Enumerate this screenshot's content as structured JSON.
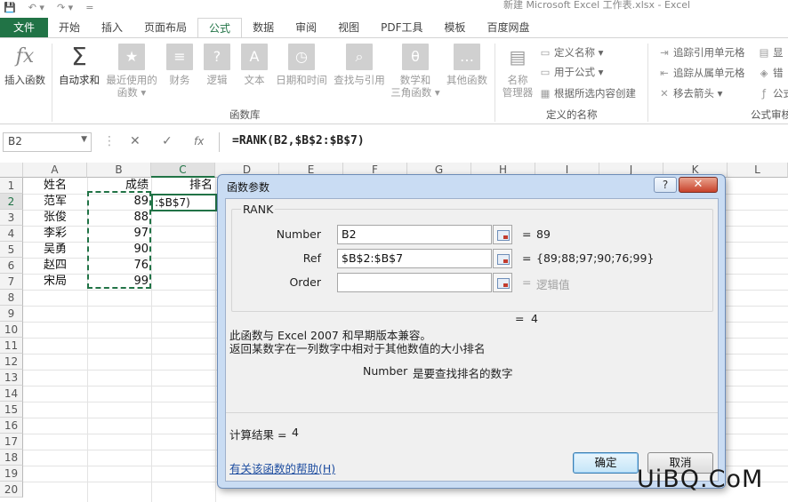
{
  "window": {
    "qat": [
      "💾",
      "↶ ▾",
      "↷ ▾",
      "="
    ],
    "title": "新建 Microsoft Excel 工作表.xlsx - Excel"
  },
  "tabs": [
    "文件",
    "开始",
    "插入",
    "页面布局",
    "公式",
    "数据",
    "审阅",
    "视图",
    "PDF工具",
    "模板",
    "百度网盘"
  ],
  "ribbon": {
    "insert_function": "插入函数",
    "autosum": "自动求和",
    "recent_line1": "最近使用的",
    "recent_line2": "函数 ▾",
    "financial": "财务",
    "logical": "逻辑",
    "text": "文本",
    "datetime": "日期和时间",
    "lookup": "查找与引用",
    "math_line1": "数学和",
    "math_line2": "三角函数 ▾",
    "other": "其他函数",
    "library_label": "函数库",
    "name_manager_line1": "名称",
    "name_manager_line2": "管理器",
    "define_name": "定义名称 ▾",
    "use_in_formula": "用于公式 ▾",
    "create_from_selection": "根据所选内容创建",
    "defined_names_label": "定义的名称",
    "trace_precedents": "追踪引用单元格",
    "trace_dependents": "追踪从属单元格",
    "remove_arrows": "移去箭头 ▾",
    "show_formulas": "显",
    "error_check": "错",
    "evaluate": "公式",
    "auditing_label": "公式审核"
  },
  "formula_bar": {
    "name_box": "B2",
    "formula": "=RANK(B2,$B$2:$B$7)"
  },
  "sheet": {
    "columns": [
      "A",
      "B",
      "C",
      "D",
      "E",
      "F",
      "G",
      "H",
      "I",
      "J",
      "K",
      "L"
    ],
    "rows": [
      "1",
      "2",
      "3",
      "4",
      "5",
      "6",
      "7",
      "8",
      "9",
      "10",
      "11",
      "12",
      "13",
      "14",
      "15",
      "16",
      "17",
      "18",
      "19",
      "20"
    ],
    "headers": {
      "name": "姓名",
      "score": "成绩",
      "rank": "排名"
    },
    "names": [
      "范军",
      "张俊",
      "李彩",
      "吴勇",
      "赵四",
      "宋局"
    ],
    "scores": [
      "89",
      "88",
      "97",
      "90",
      "76",
      "99"
    ],
    "editing_text": ":$B$7)"
  },
  "dialog": {
    "title": "函数参数",
    "help_button": "?",
    "close_button": "✕",
    "function_name": "RANK",
    "args": [
      {
        "label": "Number",
        "value": "B2",
        "result": "89"
      },
      {
        "label": "Ref",
        "value": "$B$2:$B$7",
        "result": "{89;88;97;90;76;99}"
      },
      {
        "label": "Order",
        "value": "",
        "result": "逻辑值"
      }
    ],
    "formula_result_inline": "4",
    "desc_line1": "此函数与 Excel 2007 和早期版本兼容。",
    "desc_line2": "返回某数字在一列数字中相对于其他数值的大小排名",
    "arg_help_name": "Number",
    "arg_help_text": "是要查找排名的数字",
    "calc_result_label": "计算结果 =",
    "calc_result_value": "4",
    "help_link": "有关该函数的帮助(H)",
    "ok": "确定",
    "cancel": "取消"
  },
  "watermark": "UiBQ.CoM"
}
